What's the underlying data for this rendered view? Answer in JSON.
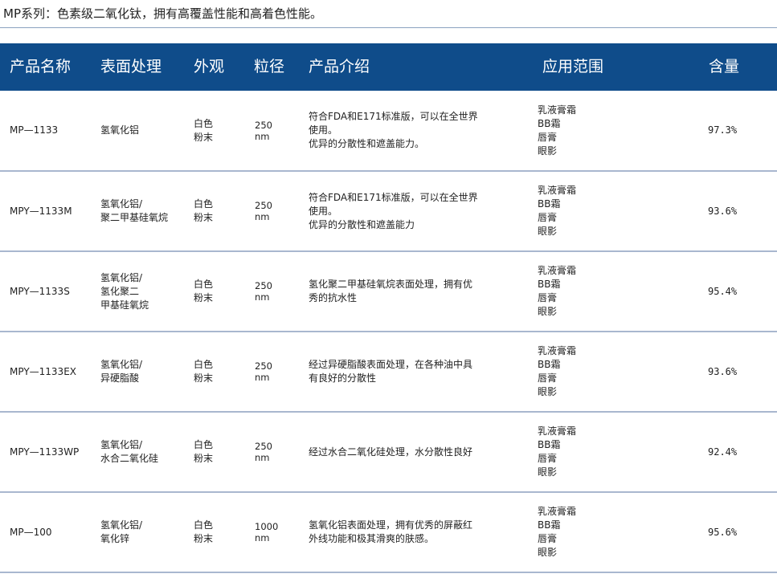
{
  "title": "MP系列：色素级二氧化钛，拥有高覆盖性能和高着色性能。",
  "colors": {
    "header_bg": "#0f4c8a",
    "row_divider": "#a9b7cf"
  },
  "headers": {
    "name": "产品名称",
    "treatment": "表面处理",
    "appearance": "外观",
    "size": "粒径",
    "description": "产品介绍",
    "application": "应用范围",
    "content": "含量"
  },
  "rows": [
    {
      "name": "MP—1133",
      "treatment": "氢氧化铝",
      "appearance": "白色\n粉末",
      "size": "250\nnm",
      "description": "符合FDA和E171标准版，可以在全世界\n使用。\n优异的分散性和遮盖能力。",
      "application": "乳液膏霜\nBB霜\n唇膏\n眼影",
      "content": "97.3%"
    },
    {
      "name": "MPY—1133M",
      "treatment": "氢氧化铝/\n聚二甲基硅氧烷",
      "appearance": "白色\n粉末",
      "size": "250\nnm",
      "description": "符合FDA和E171标准版，可以在全世界\n使用。\n优异的分散性和遮盖能力",
      "application": "乳液膏霜\nBB霜\n唇膏\n眼影",
      "content": "93.6%"
    },
    {
      "name": "MPY—1133S",
      "treatment": "氢氧化铝/\n氢化聚二\n甲基硅氧烷",
      "appearance": "白色\n粉末",
      "size": "250\nnm",
      "description": "氢化聚二甲基硅氧烷表面处理，拥有优\n秀的抗水性",
      "application": "乳液膏霜\nBB霜\n唇膏\n眼影",
      "content": "95.4%"
    },
    {
      "name": "MPY—1133EX",
      "treatment": "氢氧化铝/\n异硬脂酸",
      "appearance": "白色\n粉末",
      "size": "250\nnm",
      "description": "经过异硬脂酸表面处理，在各种油中具\n有良好的分散性",
      "application": "乳液膏霜\nBB霜\n唇膏\n眼影",
      "content": "93.6%"
    },
    {
      "name": "MPY—1133WP",
      "treatment": "氢氧化铝/\n水合二氧化硅",
      "appearance": "白色\n粉末",
      "size": "250\nnm",
      "description": "经过水合二氧化硅处理，水分散性良好",
      "application": "乳液膏霜\nBB霜\n唇膏\n眼影",
      "content": "92.4%"
    },
    {
      "name": "MP—100",
      "treatment": "氢氧化铝/\n氧化锌",
      "appearance": "白色\n粉末",
      "size": "1000\nnm",
      "description": "氢氧化铝表面处理，拥有优秀的屏蔽红\n外线功能和极其滑爽的肤感。",
      "application": "乳液膏霜\nBB霜\n唇膏\n眼影",
      "content": "95.6%"
    }
  ]
}
